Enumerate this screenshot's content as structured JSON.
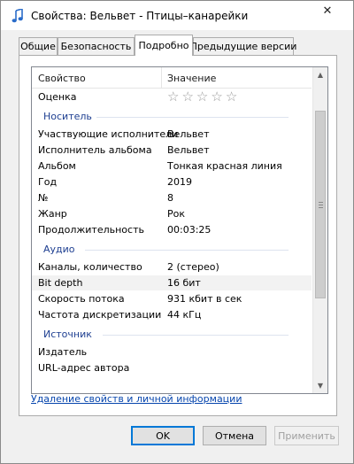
{
  "window": {
    "title": "Свойства: Вельвет - Птицы–канарейки",
    "close_glyph": "✕",
    "icon": "music-file-icon"
  },
  "tabs": [
    {
      "label": "Общие"
    },
    {
      "label": "Безопасность"
    },
    {
      "label": "Подробно",
      "active": true
    },
    {
      "label": "Предыдущие версии"
    }
  ],
  "list": {
    "header": {
      "property": "Свойство",
      "value": "Значение"
    },
    "rating": {
      "label": "Оценка",
      "stars_filled": 0,
      "stars_total": 5
    },
    "groups": {
      "media": "Носитель",
      "audio": "Аудио",
      "source": "Источник"
    },
    "media_rows": [
      {
        "label": "Участвующие исполнители",
        "value": "Вельвет"
      },
      {
        "label": "Исполнитель альбома",
        "value": "Вельвет"
      },
      {
        "label": "Альбом",
        "value": "Тонкая красная линия"
      },
      {
        "label": "Год",
        "value": "2019"
      },
      {
        "label": "№",
        "value": "8"
      },
      {
        "label": "Жанр",
        "value": "Рок"
      },
      {
        "label": "Продолжительность",
        "value": "00:03:25"
      }
    ],
    "audio_rows": [
      {
        "label": "Каналы, количество",
        "value": "2 (стерео)"
      },
      {
        "label": "Bit depth",
        "value": "16 бит"
      },
      {
        "label": "Скорость потока",
        "value": "931 кбит в сек"
      },
      {
        "label": "Частота дискретизации",
        "value": "44 кГц"
      }
    ],
    "source_rows": [
      {
        "label": "Издатель",
        "value": ""
      },
      {
        "label": "URL-адрес автора",
        "value": ""
      }
    ]
  },
  "link": "Удаление свойств и личной информации",
  "buttons": {
    "ok": "OK",
    "cancel": "Отмена",
    "apply": "Применить"
  },
  "colors": {
    "group_label": "#1e3f91",
    "link": "#0645ad",
    "ok_border": "#0078d7"
  }
}
